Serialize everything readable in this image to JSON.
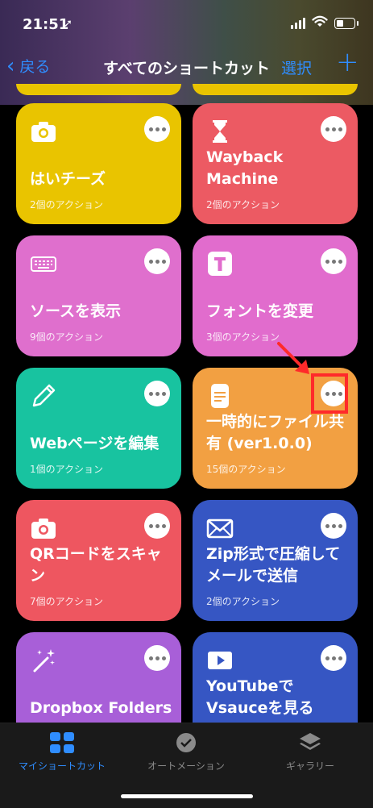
{
  "status": {
    "time": "21:51"
  },
  "nav": {
    "back_label": "戻る",
    "title": "すべてのショートカット",
    "select_label": "選択",
    "add_label": "+"
  },
  "shortcuts": [
    {
      "title": "はいチーズ",
      "subtitle": "2個のアクション",
      "icon": "camera-icon",
      "color": "#e9c400"
    },
    {
      "title": "Wayback Machine",
      "subtitle": "2個のアクション",
      "icon": "hourglass-icon",
      "color": "#ec5a63"
    },
    {
      "title": "ソースを表示",
      "subtitle": "9個のアクション",
      "icon": "keyboard-icon",
      "color": "#df6fcd"
    },
    {
      "title": "フォントを変更",
      "subtitle": "3個のアクション",
      "icon": "text-t-icon",
      "color": "#e16ccd"
    },
    {
      "title": "Webページを編集",
      "subtitle": "1個のアクション",
      "icon": "pencil-icon",
      "color": "#18c3a0"
    },
    {
      "title": "一時的にファイル共有 (ver1.0.0)",
      "subtitle": "15個のアクション",
      "icon": "document-icon",
      "color": "#f2a042"
    },
    {
      "title": "QRコードをスキャン",
      "subtitle": "7個のアクション",
      "icon": "camera-icon",
      "color": "#ee5660"
    },
    {
      "title": "Zip形式で圧縮してメールで送信",
      "subtitle": "2個のアクション",
      "icon": "envelope-icon",
      "color": "#3656c3"
    },
    {
      "title": "Dropbox Folders",
      "subtitle": "",
      "icon": "magic-wand-icon",
      "color": "#a85fd8"
    },
    {
      "title": "YouTubeでVsauceを見る",
      "subtitle": "",
      "icon": "play-icon",
      "color": "#3656c3"
    }
  ],
  "tabs": [
    {
      "label": "マイショートカット",
      "active": true
    },
    {
      "label": "オートメーション",
      "active": false
    },
    {
      "label": "ギャラリー",
      "active": false
    }
  ],
  "colors": {
    "accent": "#2f8dff",
    "highlight": "#ff2a2a"
  }
}
